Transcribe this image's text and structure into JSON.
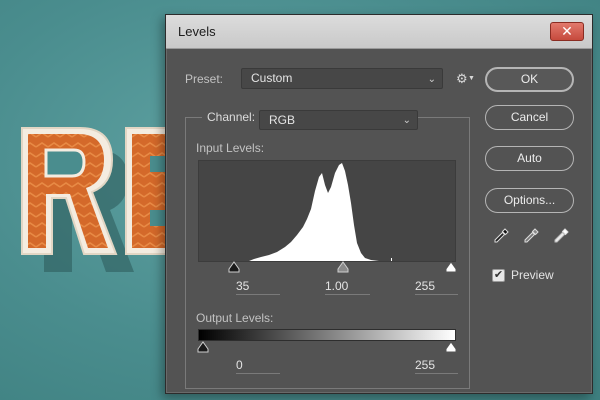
{
  "window": {
    "title": "Levels",
    "close_glyph": "✕"
  },
  "preset": {
    "label": "Preset:",
    "value": "Custom",
    "gear_icon": "gear-icon"
  },
  "buttons": {
    "ok": "OK",
    "cancel": "Cancel",
    "auto": "Auto",
    "options": "Options..."
  },
  "channel": {
    "label": "Channel:",
    "value": "RGB"
  },
  "input_levels": {
    "label": "Input Levels:",
    "black": "35",
    "gamma": "1.00",
    "white": "255"
  },
  "output_levels": {
    "label": "Output Levels:",
    "black": "0",
    "white": "255"
  },
  "preview": {
    "label": "Preview",
    "checked": true,
    "check_glyph": "✔"
  },
  "colors": {
    "dialog_bg": "#535353",
    "histogram_bg": "#454545",
    "histogram_fill": "#ffffff",
    "canvas_teal": "#4a8d8e",
    "artwork_orange": "#d4692a"
  }
}
